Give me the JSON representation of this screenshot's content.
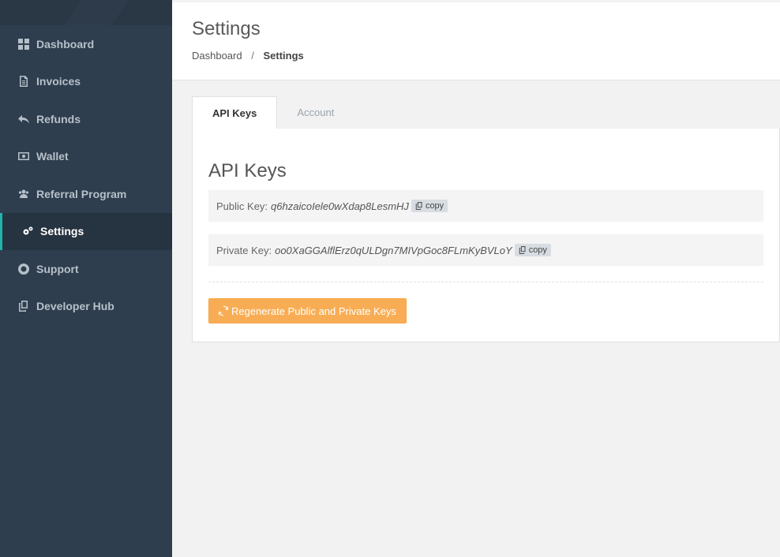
{
  "sidebar": {
    "items": [
      {
        "label": "Dashboard",
        "icon": "dashboard-icon"
      },
      {
        "label": "Invoices",
        "icon": "document-icon"
      },
      {
        "label": "Refunds",
        "icon": "reply-icon"
      },
      {
        "label": "Wallet",
        "icon": "money-icon"
      },
      {
        "label": "Referral Program",
        "icon": "users-icon"
      },
      {
        "label": "Settings",
        "icon": "gears-icon"
      },
      {
        "label": "Support",
        "icon": "lifebuoy-icon"
      },
      {
        "label": "Developer Hub",
        "icon": "copy-icon"
      }
    ],
    "active_index": 5,
    "accent_color": "#1fb5ac"
  },
  "header": {
    "title": "Settings",
    "breadcrumb": {
      "root": "Dashboard",
      "separator": "/",
      "current": "Settings"
    }
  },
  "tabs": [
    {
      "label": "API Keys",
      "active": true
    },
    {
      "label": "Account",
      "active": false
    }
  ],
  "panel": {
    "title": "API Keys",
    "public_key_label": "Public Key:",
    "public_key_value": "q6hzaicoIele0wXdap8LesmHJ",
    "private_key_label": "Private Key:",
    "private_key_value": "oo0XaGGAlflErz0qULDgn7MIVpGoc8FLmKyBVLoY",
    "copy_label": "copy",
    "regenerate_label": "Regenerate Public and Private Keys",
    "regenerate_color": "#f8ad55"
  }
}
